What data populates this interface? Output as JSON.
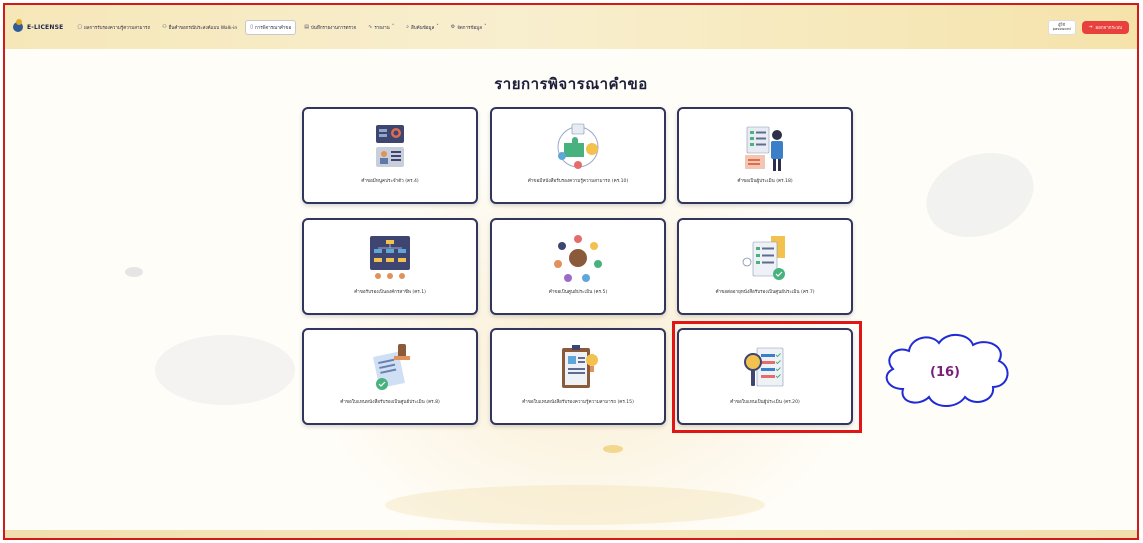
{
  "app": {
    "brand": "E-LICENSE"
  },
  "nav": [
    {
      "icon": "document-icon",
      "label": "ผลการรับรองความรู้ความสามารถ",
      "active": false
    },
    {
      "icon": "users-icon",
      "label": "ยื่นคำขอกรณีประสงค์แบบ Walk-in",
      "active": false
    },
    {
      "icon": "clipboard-icon",
      "label": "การพิจารณาคำขอ",
      "active": true
    },
    {
      "icon": "file-icon",
      "label": "บันทึกรายงานการตรวจ",
      "active": false
    },
    {
      "icon": "chart-icon",
      "label": "รายงาน",
      "active": false,
      "dropdown": true
    },
    {
      "icon": "search-icon",
      "label": "สืบค้นข้อมูล",
      "active": false,
      "dropdown": true
    },
    {
      "icon": "gear-icon",
      "label": "จัดการข้อมูล",
      "active": false,
      "dropdown": true
    }
  ],
  "user": {
    "line1": "ผู้ใช้",
    "line2": "password"
  },
  "logout_label": "ออกจากระบบ",
  "page_title": "รายการพิจารณาคำขอ",
  "cards": [
    {
      "label": "คำขอมีหนูคประจำตัว (คร.4)",
      "icon": "id-card-icon"
    },
    {
      "label": "คำขอมีหนังสือรับรองความรู้ความสามารถ (คร.10)",
      "icon": "puzzle-icon"
    },
    {
      "label": "คำขอเป็นผู้ประเมิน (คร.18)",
      "icon": "presenter-icon"
    },
    {
      "label": "คำขอรับรองเป็นองค์กรสาชีพ (คร.1)",
      "icon": "org-chart-icon"
    },
    {
      "label": "คำขอเป็นศูนย์ประเมิน (คร.5)",
      "icon": "team-icon"
    },
    {
      "label": "คำขอต่ออายุหนังสือรับรองเป็นศูนย์ประเมิน (คร.7)",
      "icon": "checklist-icon"
    },
    {
      "label": "คำขอใบแทนหนังสือรับรองเป็นศูนย์ประเมิน (คร.8)",
      "icon": "stamp-icon"
    },
    {
      "label": "คำขอใบแทนหนังสือรับรองความรู้ความสามารถ (คร.15)",
      "icon": "report-icon"
    },
    {
      "label": "คำขอใบแทนเป็นผู้ประเมิน (คร.20)",
      "icon": "search-list-icon"
    }
  ],
  "callout": "(16)"
}
